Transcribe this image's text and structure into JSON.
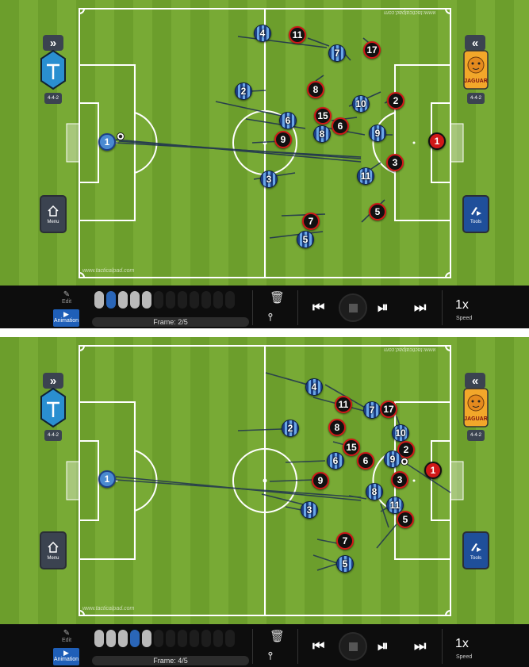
{
  "screens": [
    {
      "frame_label": "Frame: 2/5",
      "frames_total": 12,
      "frames_used": 5,
      "active_frame": 2
    },
    {
      "frame_label": "Frame: 4/5",
      "frames_total": 12,
      "frames_used": 5,
      "active_frame": 4
    }
  ],
  "toolbar": {
    "edit_label": "Edit",
    "animation_label": "Animation",
    "speed_value": "1x",
    "speed_label": "Speed"
  },
  "sidebar": {
    "menu_label": "Menu",
    "tools_label": "Tools",
    "collapse_left": "»",
    "collapse_right": "«",
    "formation_label": "4-4-2"
  },
  "watermarks": {
    "bottom": "www.tacticalpad.com",
    "top": "www.tacticalpad.com"
  },
  "teams": {
    "home_color": "#2a66b8",
    "away_color": "#d01818",
    "away_logo_text": "JAGUAR"
  },
  "icons": {
    "home": "house-icon",
    "tools": "pen-play-icon",
    "trash": "trash-icon",
    "hierarchy": "hierarchy-icon",
    "prev": "skip-back-icon",
    "stop": "stop-icon",
    "playpause": "play-pause-icon",
    "next": "skip-forward-icon"
  }
}
